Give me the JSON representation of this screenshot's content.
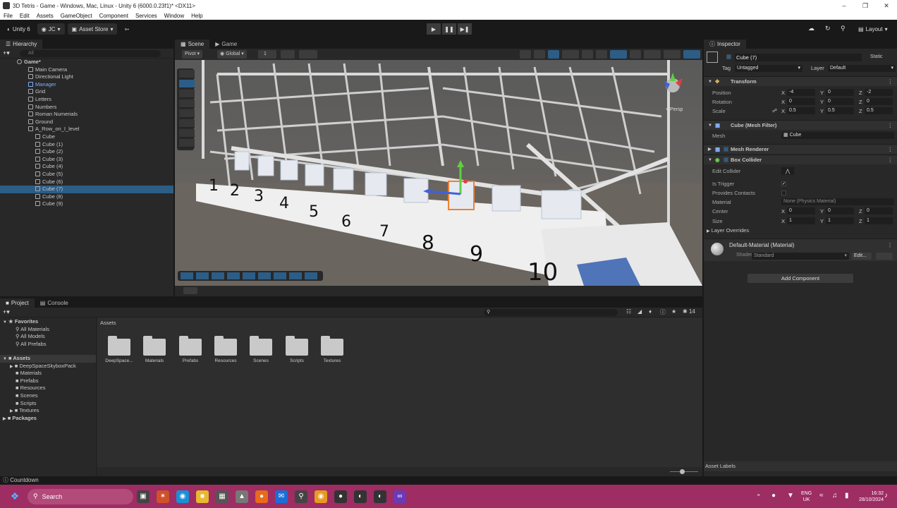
{
  "window": {
    "title": "3D Tetris - Game - Windows, Mac, Linux - Unity 6 (6000.0.23f1)* <DX11>"
  },
  "menu": [
    "File",
    "Edit",
    "Assets",
    "GameObject",
    "Component",
    "Services",
    "Window",
    "Help"
  ],
  "toolbar": {
    "unity": "Unity 6",
    "account": "JC",
    "asset_store": "Asset Store",
    "layout": "Layout"
  },
  "hierarchy": {
    "tab": "Hierarchy",
    "search_placeholder": "All",
    "items": [
      {
        "label": "Game*",
        "indent": 0
      },
      {
        "label": "Main Camera",
        "indent": 1
      },
      {
        "label": "Directional Light",
        "indent": 1
      },
      {
        "label": "Manager",
        "indent": 1
      },
      {
        "label": "Grid",
        "indent": 1
      },
      {
        "label": "Letters",
        "indent": 1
      },
      {
        "label": "Numbers",
        "indent": 1
      },
      {
        "label": "Roman Numerials",
        "indent": 1
      },
      {
        "label": "Ground",
        "indent": 1
      },
      {
        "label": "A_Row_on_I_level",
        "indent": 1
      },
      {
        "label": "Cube",
        "indent": 2
      },
      {
        "label": "Cube (1)",
        "indent": 2
      },
      {
        "label": "Cube (2)",
        "indent": 2
      },
      {
        "label": "Cube (3)",
        "indent": 2
      },
      {
        "label": "Cube (4)",
        "indent": 2
      },
      {
        "label": "Cube (5)",
        "indent": 2
      },
      {
        "label": "Cube (6)",
        "indent": 2
      },
      {
        "label": "Cube (7)",
        "indent": 2
      },
      {
        "label": "Cube (8)",
        "indent": 2
      },
      {
        "label": "Cube (9)",
        "indent": 2
      }
    ],
    "selected": "Cube (7)"
  },
  "scene": {
    "tabs": [
      "Scene",
      "Game"
    ],
    "pivot": "Pivot",
    "global": "Global",
    "grid_snap": "1",
    "persp": "< Persp",
    "floor_numbers": [
      "1",
      "2",
      "3",
      "4",
      "5",
      "6",
      "7",
      "8",
      "9",
      "10"
    ]
  },
  "inspector": {
    "tab": "Inspector",
    "object_name": "Cube (7)",
    "static": "Static",
    "tag_label": "Tag",
    "tag": "Untagged",
    "layer_label": "Layer",
    "layer": "Default",
    "transform": {
      "title": "Transform",
      "position_label": "Position",
      "position": {
        "x": "-4",
        "y": "0",
        "z": "-2"
      },
      "rotation_label": "Rotation",
      "rotation": {
        "x": "0",
        "y": "0",
        "z": "0"
      },
      "scale_label": "Scale",
      "scale": {
        "x": "0.5",
        "y": "0.5",
        "z": "0.5"
      }
    },
    "mesh_filter": {
      "title": "Cube (Mesh Filter)",
      "mesh_label": "Mesh",
      "mesh": "Cube"
    },
    "mesh_renderer": {
      "title": "Mesh Renderer"
    },
    "box_collider": {
      "title": "Box Collider",
      "edit_collider": "Edit Collider",
      "is_trigger": "Is Trigger",
      "provides_contacts": "Provides Contacts",
      "material_label": "Material",
      "material": "None (Physics Material)",
      "center_label": "Center",
      "center": {
        "x": "0",
        "y": "0",
        "z": "0"
      },
      "size_label": "Size",
      "size": {
        "x": "1",
        "y": "1",
        "z": "1"
      },
      "layer_overrides": "Layer Overrides"
    },
    "material": {
      "title": "Default-Material (Material)",
      "shader_label": "Shader",
      "shader": "Standard",
      "edit": "Edit..."
    },
    "add_component": "Add Component",
    "asset_labels": "Asset Labels"
  },
  "project": {
    "tabs": [
      "Project",
      "Console"
    ],
    "favorites": {
      "label": "Favorites",
      "items": [
        "All Materials",
        "All Models",
        "All Prefabs"
      ]
    },
    "assets_tree": {
      "label": "Assets",
      "items": [
        "DeepSpaceSkyboxPack",
        "Materials",
        "Prefabs",
        "Resources",
        "Scenes",
        "Scripts",
        "Textures"
      ]
    },
    "packages": "Packages",
    "breadcrumb": "Assets",
    "folders": [
      "DeepSpace...",
      "Materials",
      "Prefabs",
      "Resources",
      "Scenes",
      "Scripts",
      "Textures"
    ],
    "count": "14"
  },
  "status": {
    "text": "Countdown"
  },
  "taskbar": {
    "search": "Search",
    "lang": "ENG",
    "region": "UK",
    "time": "16:32",
    "date": "28/10/2024"
  }
}
